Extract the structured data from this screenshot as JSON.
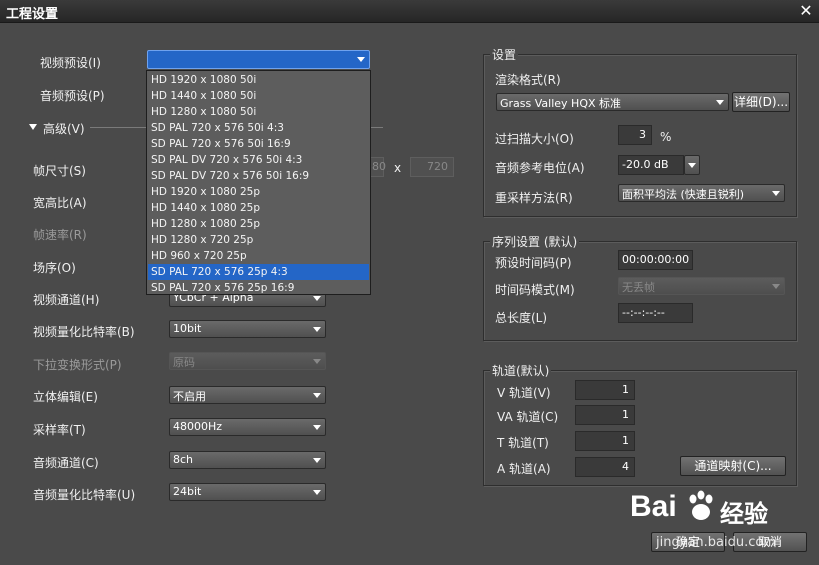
{
  "window": {
    "title": "工程设置"
  },
  "left": {
    "video_preset_label": "视频预设(I)",
    "audio_preset_label": "音频预设(P)",
    "advanced_label": "高级(V)",
    "frame_size_label": "帧尺寸(S)",
    "frame_w": "80",
    "frame_x": "x",
    "frame_h": "720",
    "aspect_label": "宽高比(A)",
    "framerate_label": "帧速率(R)",
    "field_order_label": "场序(O)",
    "video_channel_label": "视频通道(H)",
    "video_channel_value": "YCbCr + Alpha",
    "video_bitdepth_label": "视频量化比特率(B)",
    "video_bitdepth_value": "10bit",
    "pulldown_label": "下拉变换形式(P)",
    "pulldown_value": "原码",
    "stereo_label": "立体编辑(E)",
    "stereo_value": "不启用",
    "samplerate_label": "采样率(T)",
    "samplerate_value": "48000Hz",
    "audio_channel_label": "音频通道(C)",
    "audio_channel_value": "8ch",
    "audio_bitdepth_label": "音频量化比特率(U)",
    "audio_bitdepth_value": "24bit"
  },
  "dropdown": {
    "items": [
      "HD 1920 x 1080 50i",
      "HD 1440 x 1080 50i",
      "HD 1280 x 1080 50i",
      "SD PAL 720 x 576 50i 4:3",
      "SD PAL 720 x 576 50i 16:9",
      "SD PAL DV 720 x 576 50i 4:3",
      "SD PAL DV 720 x 576 50i 16:9",
      "HD 1920 x 1080 25p",
      "HD 1440 x 1080 25p",
      "HD 1280 x 1080 25p",
      "HD 1280 x 720 25p",
      "HD 960 x 720 25p",
      "SD PAL 720 x 576 25p 4:3",
      "SD PAL 720 x 576 25p 16:9"
    ],
    "selected_index": 12
  },
  "settings": {
    "group_title": "设置",
    "render_format_label": "渲染格式(R)",
    "render_format_value": "Grass Valley HQX 标准",
    "detail_button": "详细(D)...",
    "overscan_label": "过扫描大小(O)",
    "overscan_value": "3",
    "overscan_unit": "%",
    "audio_ref_label": "音频参考电位(A)",
    "audio_ref_value": "-20.0 dB",
    "resample_label": "重采样方法(R)",
    "resample_value": "面积平均法 (快速且锐利)"
  },
  "sequence": {
    "group_title": "序列设置 (默认)",
    "timecode_label": "预设时间码(P)",
    "timecode_value": "00:00:00:00",
    "tc_mode_label": "时间码模式(M)",
    "tc_mode_value": "无丢帧",
    "total_length_label": "总长度(L)",
    "total_length_value": "--:--:--:--"
  },
  "tracks": {
    "group_title": "轨道(默认)",
    "v_label": "V 轨道(V)",
    "v_value": "1",
    "va_label": "VA 轨道(C)",
    "va_value": "1",
    "t_label": "T 轨道(T)",
    "t_value": "1",
    "a_label": "A 轨道(A)",
    "a_value": "4",
    "channel_map_button": "通道映射(C)..."
  },
  "footer": {
    "ok_button": "确定",
    "cancel_button": "取消"
  },
  "watermark": {
    "brand": "Bai",
    "brand2": "经验",
    "url": "jingyan.baidu.com"
  },
  "colors": {
    "accent": "#2466c7",
    "background": "#4a4a4a"
  }
}
